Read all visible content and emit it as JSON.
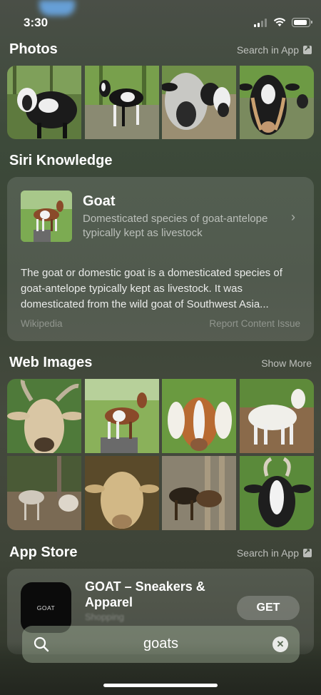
{
  "status": {
    "time": "3:30"
  },
  "photos": {
    "title": "Photos",
    "link": "Search in App"
  },
  "siri": {
    "title": "Siri Knowledge",
    "item_title": "Goat",
    "item_subtitle": "Domesticated species of goat-antelope typically kept as livestock",
    "body": "The goat or domestic goat is a domesticated species of goat-antelope typically kept as livestock. It was domesticated from the wild goat of Southwest Asia...",
    "source": "Wikipedia",
    "report": "Report Content Issue"
  },
  "web_images": {
    "title": "Web Images",
    "link": "Show More"
  },
  "app_store": {
    "title": "App Store",
    "link": "Search in App",
    "app_name": "GOAT – Sneakers & Apparel",
    "app_icon_text": "GOAT",
    "app_category": "Shopping",
    "get_label": "GET"
  },
  "search": {
    "query": "goats"
  },
  "colors": {
    "accent": "#ffffff",
    "card_bg": "rgba(255,255,255,0.12)"
  }
}
